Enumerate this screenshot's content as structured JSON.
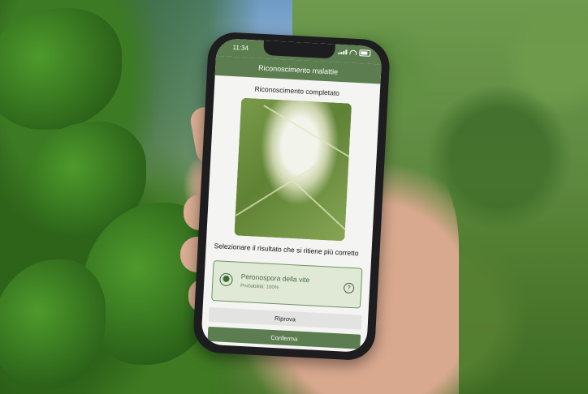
{
  "status_bar": {
    "time": "11:34"
  },
  "app": {
    "title": "Riconoscimento malattie"
  },
  "recognition": {
    "status": "Riconoscimento completato",
    "prompt": "Selezionare il risultato che si ritiene più corretto"
  },
  "result": {
    "name": "Peronospora della vite",
    "probability": "Probabilità: 100%",
    "selected": true,
    "help_symbol": "?"
  },
  "buttons": {
    "retry_label": "Riprova",
    "confirm_label": "Conferma"
  },
  "colors": {
    "accent": "#5b7d4f",
    "result_background": "#dfe9d6"
  },
  "icons": [
    "signal-icon",
    "wifi-icon",
    "battery-icon",
    "radio-selected-icon",
    "help-icon"
  ]
}
